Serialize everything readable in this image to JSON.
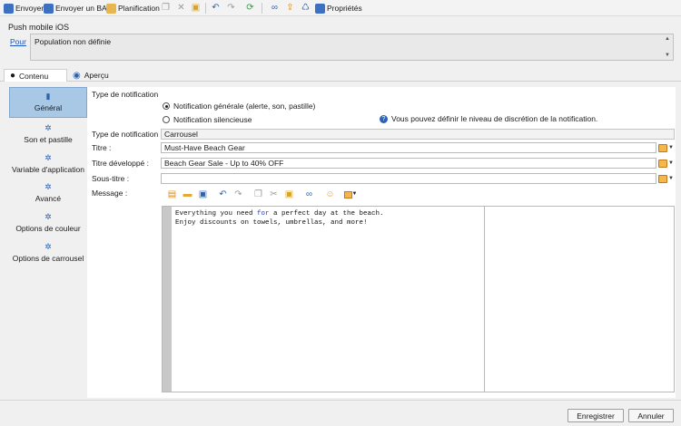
{
  "toolbar": {
    "send": "Envoyer",
    "send_proof": "Envoyer un BAT",
    "schedule": "Planification",
    "properties": "Propriétés"
  },
  "header": {
    "title": "Push mobile iOS",
    "pour_link": "Pour",
    "population": "Population non définie"
  },
  "tabs": [
    {
      "label": "Contenu"
    },
    {
      "label": "Aperçu"
    }
  ],
  "sidebar": {
    "items": [
      {
        "label": "Général"
      },
      {
        "label": "Son et pastille"
      },
      {
        "label": "Variable d'application"
      },
      {
        "label": "Avancé"
      },
      {
        "label": "Options de couleur"
      },
      {
        "label": "Options de carrousel"
      }
    ]
  },
  "notification": {
    "section_label": "Type de notification",
    "option_general": "Notification générale (alerte, son, pastille)",
    "option_silent": "Notification silencieuse",
    "info_text": "Vous pouvez définir le niveau de discrétion de la notification.",
    "type_label": "Type de notification :",
    "type_value": "Carrousel",
    "title_label": "Titre :",
    "title_value": "Must-Have Beach Gear",
    "extended_title_label": "Titre développé :",
    "extended_title_value": "Beach Gear Sale - Up to 40% OFF",
    "subtitle_label": "Sous-titre :",
    "subtitle_value": "",
    "message_label": "Message :",
    "message_line1_a": "Everything you need ",
    "message_line1_kw": "for",
    "message_line1_b": " a perfect day at the beach.",
    "message_line2": "Enjoy discounts on towels, umbrellas, and more!"
  },
  "footer": {
    "save": "Enregistrer",
    "cancel": "Annuler"
  },
  "colors": {
    "accent": "#2c64b3",
    "nav_active": "#a9c8e6",
    "keyword": "#2142b8"
  }
}
